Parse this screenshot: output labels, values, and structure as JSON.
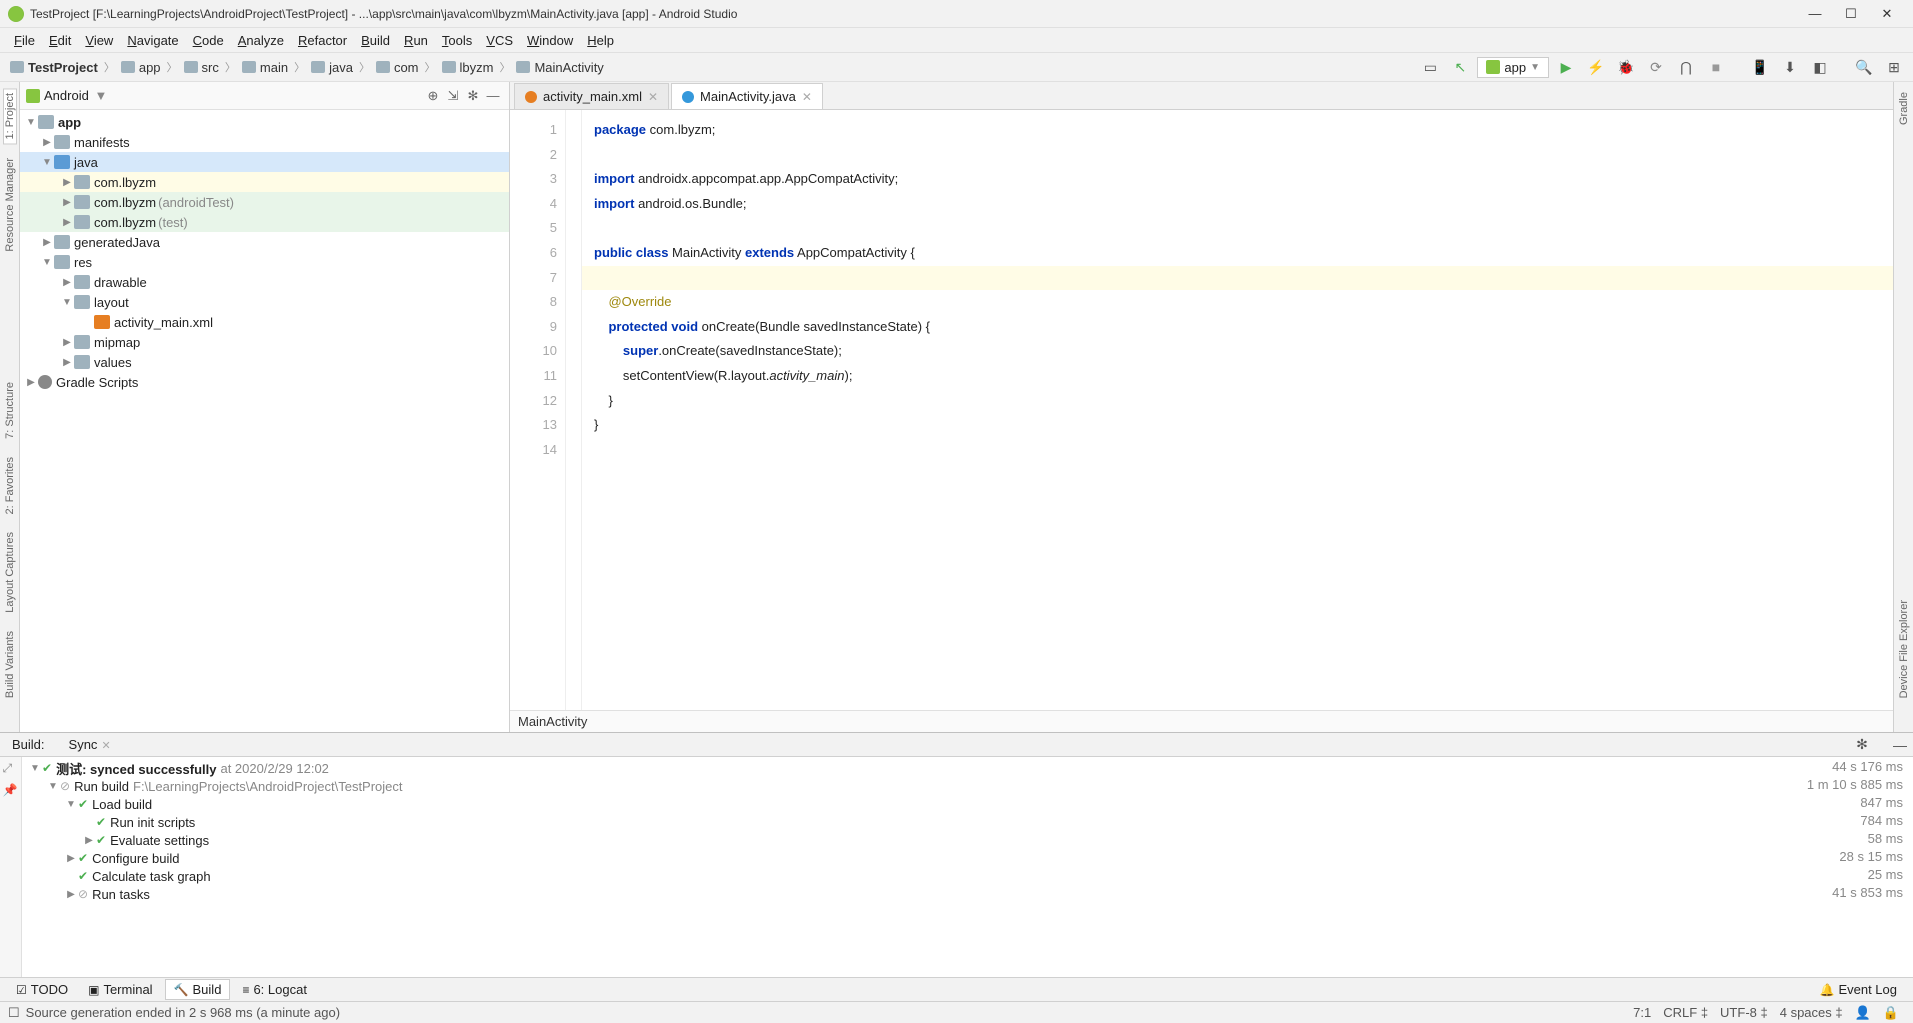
{
  "window_title": "TestProject [F:\\LearningProjects\\AndroidProject\\TestProject] - ...\\app\\src\\main\\java\\com\\lbyzm\\MainActivity.java [app] - Android Studio",
  "menu": [
    "File",
    "Edit",
    "View",
    "Navigate",
    "Code",
    "Analyze",
    "Refactor",
    "Build",
    "Run",
    "Tools",
    "VCS",
    "Window",
    "Help"
  ],
  "breadcrumb": [
    "TestProject",
    "app",
    "src",
    "main",
    "java",
    "com",
    "lbyzm",
    "MainActivity"
  ],
  "run_config": "app",
  "project_view": "Android",
  "tree": {
    "app": "app",
    "manifests": "manifests",
    "java": "java",
    "pkg1": "com.lbyzm",
    "pkg2": "com.lbyzm",
    "pkg2_suffix": "(androidTest)",
    "pkg3": "com.lbyzm",
    "pkg3_suffix": "(test)",
    "genjava": "generatedJava",
    "res": "res",
    "drawable": "drawable",
    "layout": "layout",
    "activity_xml": "activity_main.xml",
    "mipmap": "mipmap",
    "values": "values",
    "gradle": "Gradle Scripts"
  },
  "tabs": [
    {
      "label": "activity_main.xml",
      "icon": "xml",
      "active": false
    },
    {
      "label": "MainActivity.java",
      "icon": "java",
      "active": true
    }
  ],
  "code_lines": [
    {
      "n": 1,
      "t": "<kw>package</kw> com.lbyzm;"
    },
    {
      "n": 2,
      "t": ""
    },
    {
      "n": 3,
      "t": "<kw>import</kw> androidx.appcompat.app.AppCompatActivity;"
    },
    {
      "n": 4,
      "t": "<kw>import</kw> android.os.Bundle;"
    },
    {
      "n": 5,
      "t": ""
    },
    {
      "n": 6,
      "t": "<kw>public class</kw> MainActivity <kw>extends</kw> AppCompatActivity {"
    },
    {
      "n": 7,
      "t": "",
      "cur": true
    },
    {
      "n": 8,
      "t": "    <ann>@Override</ann>"
    },
    {
      "n": 9,
      "t": "    <kw>protected void</kw> onCreate(Bundle savedInstanceState) {"
    },
    {
      "n": 10,
      "t": "        <kw>super</kw>.onCreate(savedInstanceState);"
    },
    {
      "n": 11,
      "t": "        setContentView(R.layout.<i>activity_main</i>);"
    },
    {
      "n": 12,
      "t": "    }"
    },
    {
      "n": 13,
      "t": "}"
    },
    {
      "n": 14,
      "t": ""
    }
  ],
  "editor_crumb": "MainActivity",
  "build": {
    "tab1": "Build:",
    "tab2": "Sync",
    "root": "测试: synced successfully",
    "root_time": "at 2020/2/29 12:02",
    "items": [
      {
        "depth": 1,
        "arrow": "exp",
        "icon": "skip",
        "text": "Run build",
        "path": "F:\\LearningProjects\\AndroidProject\\TestProject"
      },
      {
        "depth": 2,
        "arrow": "exp",
        "icon": "check",
        "text": "Load build"
      },
      {
        "depth": 3,
        "arrow": "none",
        "icon": "check",
        "text": "Run init scripts"
      },
      {
        "depth": 3,
        "arrow": "col",
        "icon": "check",
        "text": "Evaluate settings"
      },
      {
        "depth": 2,
        "arrow": "col",
        "icon": "check",
        "text": "Configure build"
      },
      {
        "depth": 2,
        "arrow": "none",
        "icon": "check",
        "text": "Calculate task graph"
      },
      {
        "depth": 2,
        "arrow": "col",
        "icon": "skip",
        "text": "Run tasks"
      }
    ],
    "times": [
      "44 s 176 ms",
      "1 m 10 s 885 ms",
      "847 ms",
      "784 ms",
      "58 ms",
      "28 s 15 ms",
      "25 ms",
      "41 s 853 ms"
    ]
  },
  "bottom_tabs": {
    "todo": "TODO",
    "terminal": "Terminal",
    "build": "Build",
    "logcat": "6: Logcat",
    "eventlog": "Event Log"
  },
  "status": {
    "msg": "Source generation ended in 2 s 968 ms (a minute ago)",
    "pos": "7:1",
    "lf": "CRLF",
    "enc": "UTF-8",
    "indent": "4 spaces"
  },
  "left_strips": [
    "1: Project",
    "Resource Manager",
    "7: Structure",
    "2: Favorites",
    "Layout Captures",
    "Build Variants"
  ],
  "right_strips": [
    "Gradle",
    "Device File Explorer"
  ]
}
